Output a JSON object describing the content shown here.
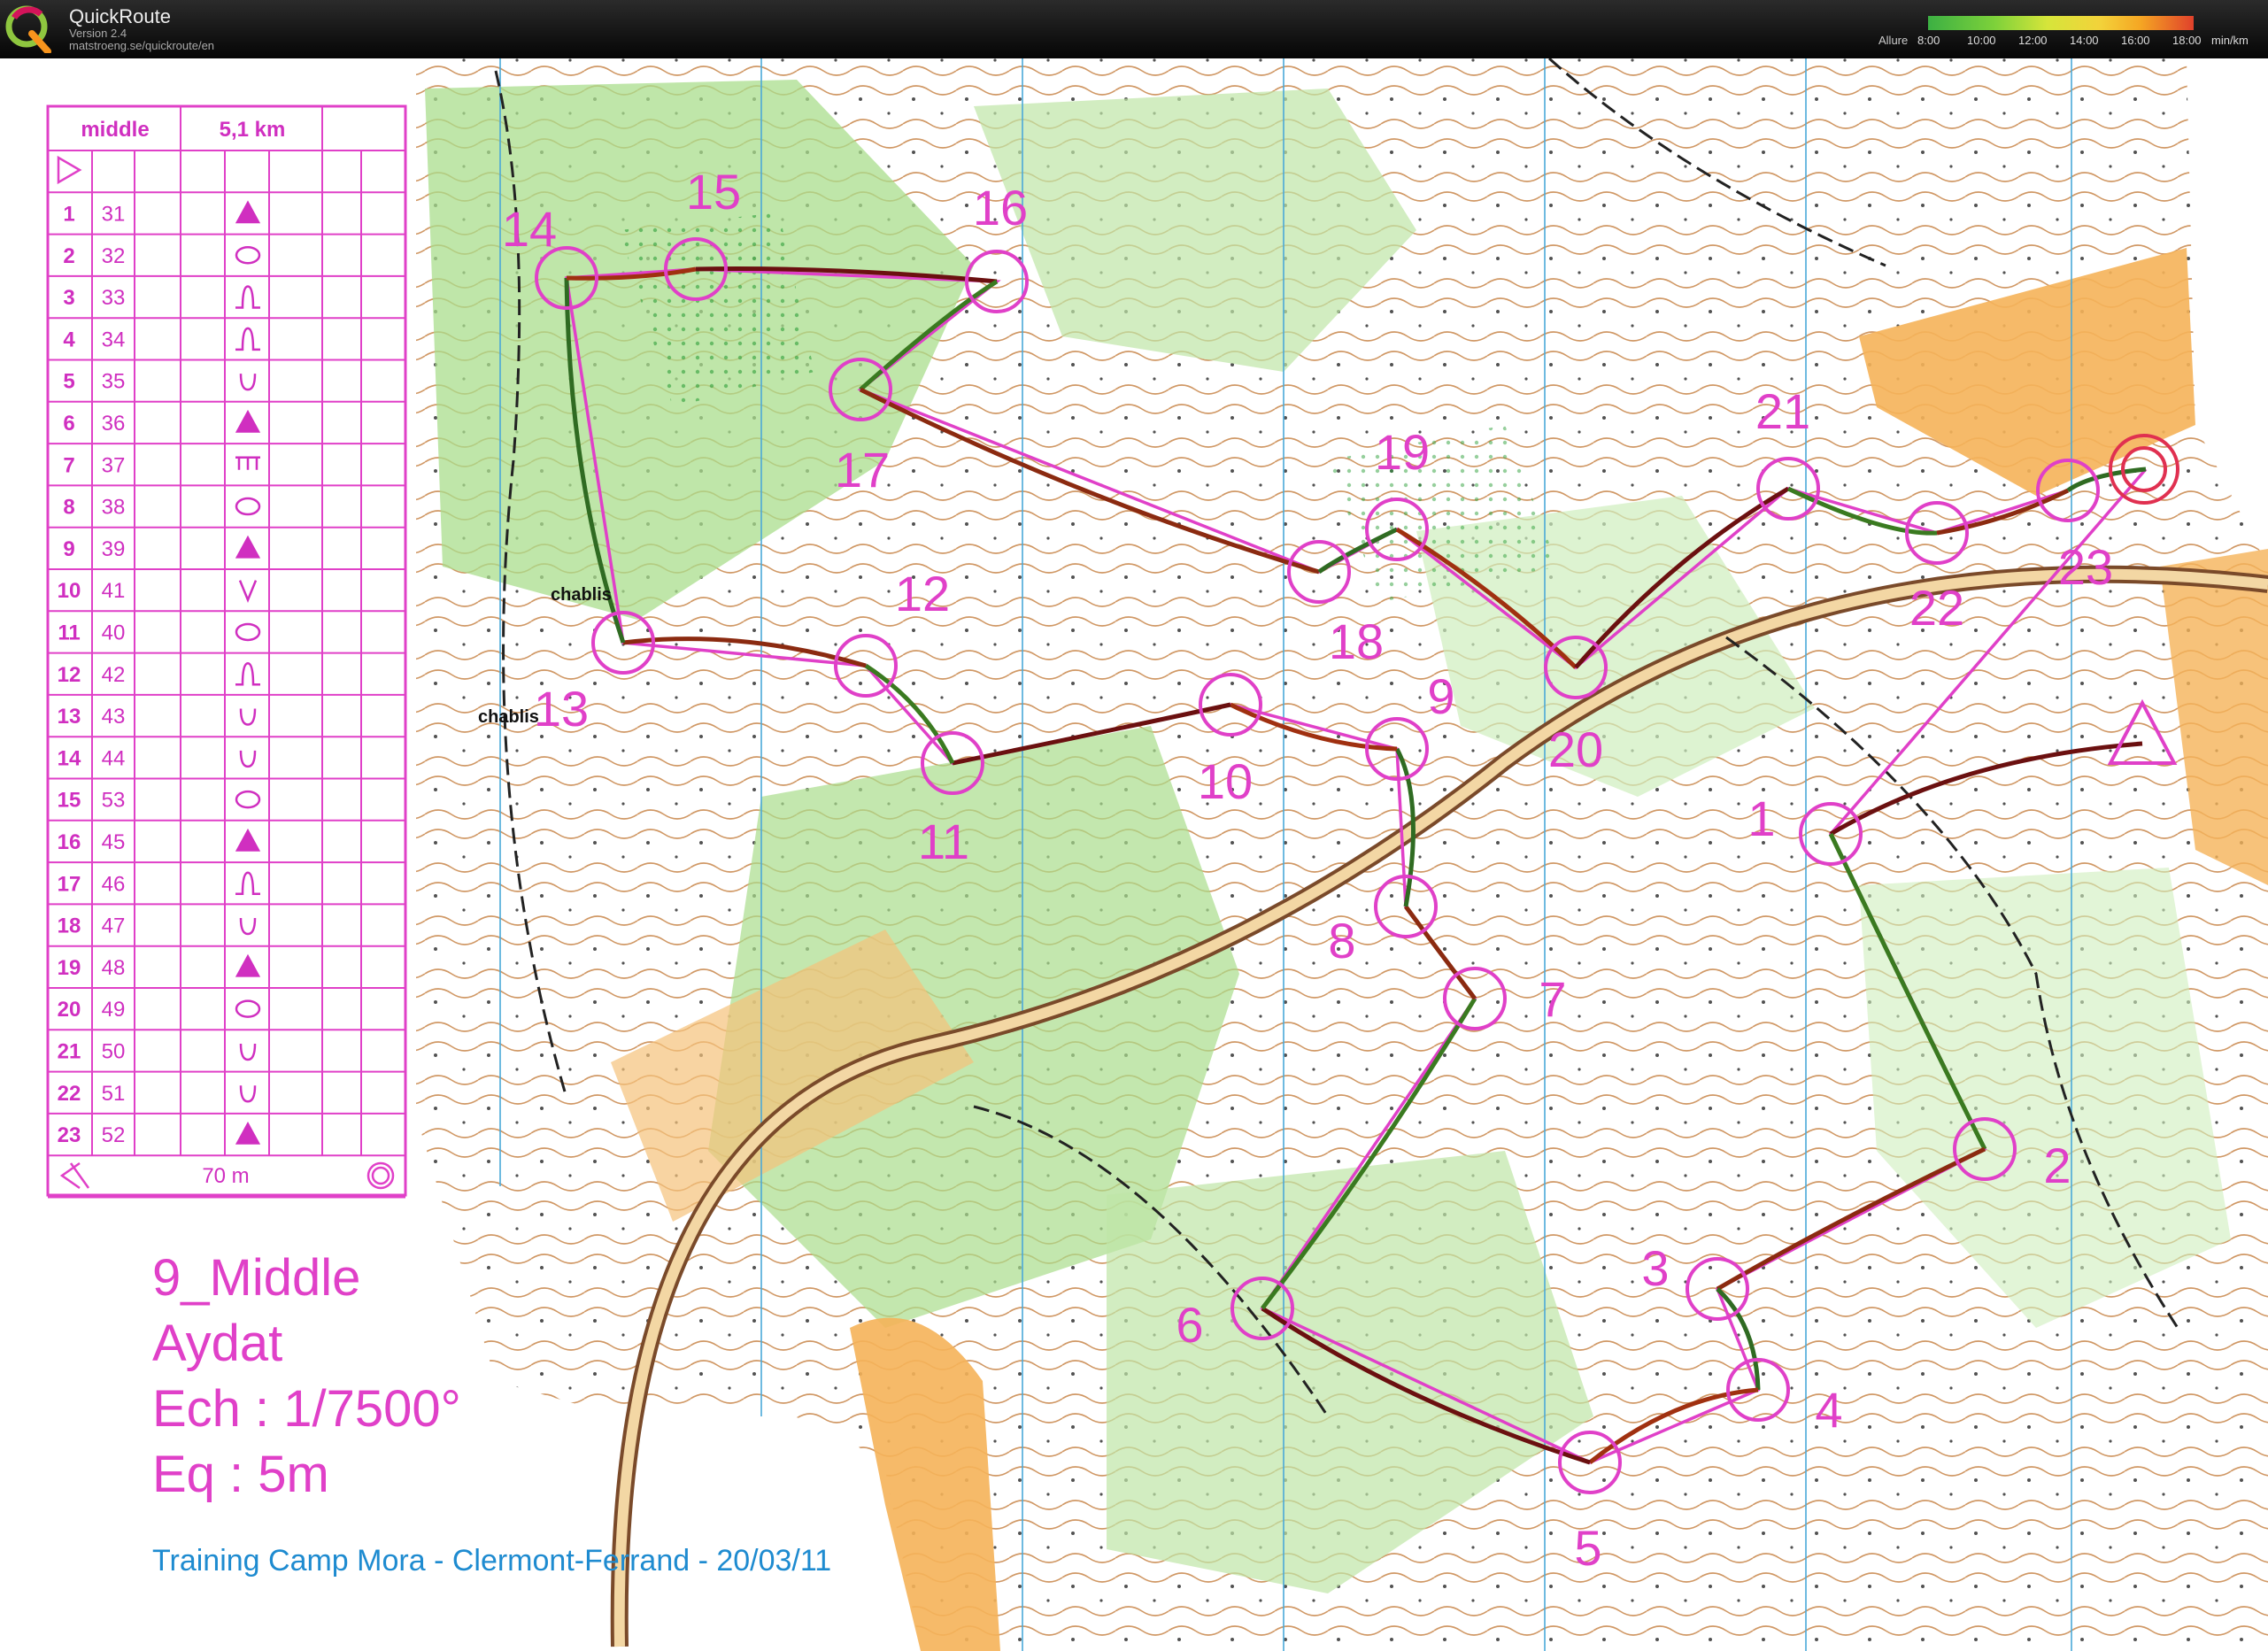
{
  "app": {
    "name": "QuickRoute",
    "version": "Version 2.4",
    "url": "matstroeng.se/quickroute/en",
    "logo_letter": "Q"
  },
  "pace_legend": {
    "label": "Allure",
    "ticks": [
      "8:00",
      "10:00",
      "12:00",
      "14:00",
      "16:00",
      "18:00"
    ],
    "unit": "min/km",
    "colors": [
      "#3cb043",
      "#7dd13a",
      "#c9e33a",
      "#f3e33a",
      "#f5a623",
      "#e0412b"
    ]
  },
  "course": {
    "name_short": "middle",
    "length": "5,1 km",
    "finish_distance": "70 m",
    "rows": [
      {
        "n": "1",
        "code": "31",
        "sym": "tri"
      },
      {
        "n": "2",
        "code": "32",
        "sym": "oval-dash"
      },
      {
        "n": "3",
        "code": "33",
        "sym": "knoll"
      },
      {
        "n": "4",
        "code": "34",
        "sym": "knoll"
      },
      {
        "n": "5",
        "code": "35",
        "sym": "cup"
      },
      {
        "n": "6",
        "code": "36",
        "sym": "tri"
      },
      {
        "n": "7",
        "code": "37",
        "sym": "comb"
      },
      {
        "n": "8",
        "code": "38",
        "sym": "oval-dash"
      },
      {
        "n": "9",
        "code": "39",
        "sym": "tri"
      },
      {
        "n": "10",
        "code": "41",
        "sym": "vee"
      },
      {
        "n": "11",
        "code": "40",
        "sym": "oval"
      },
      {
        "n": "12",
        "code": "42",
        "sym": "knoll"
      },
      {
        "n": "13",
        "code": "43",
        "sym": "cup"
      },
      {
        "n": "14",
        "code": "44",
        "sym": "cup"
      },
      {
        "n": "15",
        "code": "53",
        "sym": "oval"
      },
      {
        "n": "16",
        "code": "45",
        "sym": "tri"
      },
      {
        "n": "17",
        "code": "46",
        "sym": "knoll"
      },
      {
        "n": "18",
        "code": "47",
        "sym": "cup"
      },
      {
        "n": "19",
        "code": "48",
        "sym": "tri"
      },
      {
        "n": "20",
        "code": "49",
        "sym": "oval-dash"
      },
      {
        "n": "21",
        "code": "50",
        "sym": "cup"
      },
      {
        "n": "22",
        "code": "51",
        "sym": "cup"
      },
      {
        "n": "23",
        "code": "52",
        "sym": "tri"
      }
    ]
  },
  "map_info": {
    "title": "9_Middle",
    "area": "Aydat",
    "scale": "Ech : 1/7500°",
    "equidistance": "Eq : 5m",
    "footer": "Training Camp Mora - Clermont-Ferrand - 20/03/11"
  },
  "place_labels": [
    "chablis",
    "chablis"
  ],
  "controls": [
    "1",
    "2",
    "3",
    "4",
    "5",
    "6",
    "7",
    "8",
    "9",
    "10",
    "11",
    "12",
    "13",
    "14",
    "15",
    "16",
    "17",
    "18",
    "19",
    "20",
    "21",
    "22",
    "23"
  ]
}
